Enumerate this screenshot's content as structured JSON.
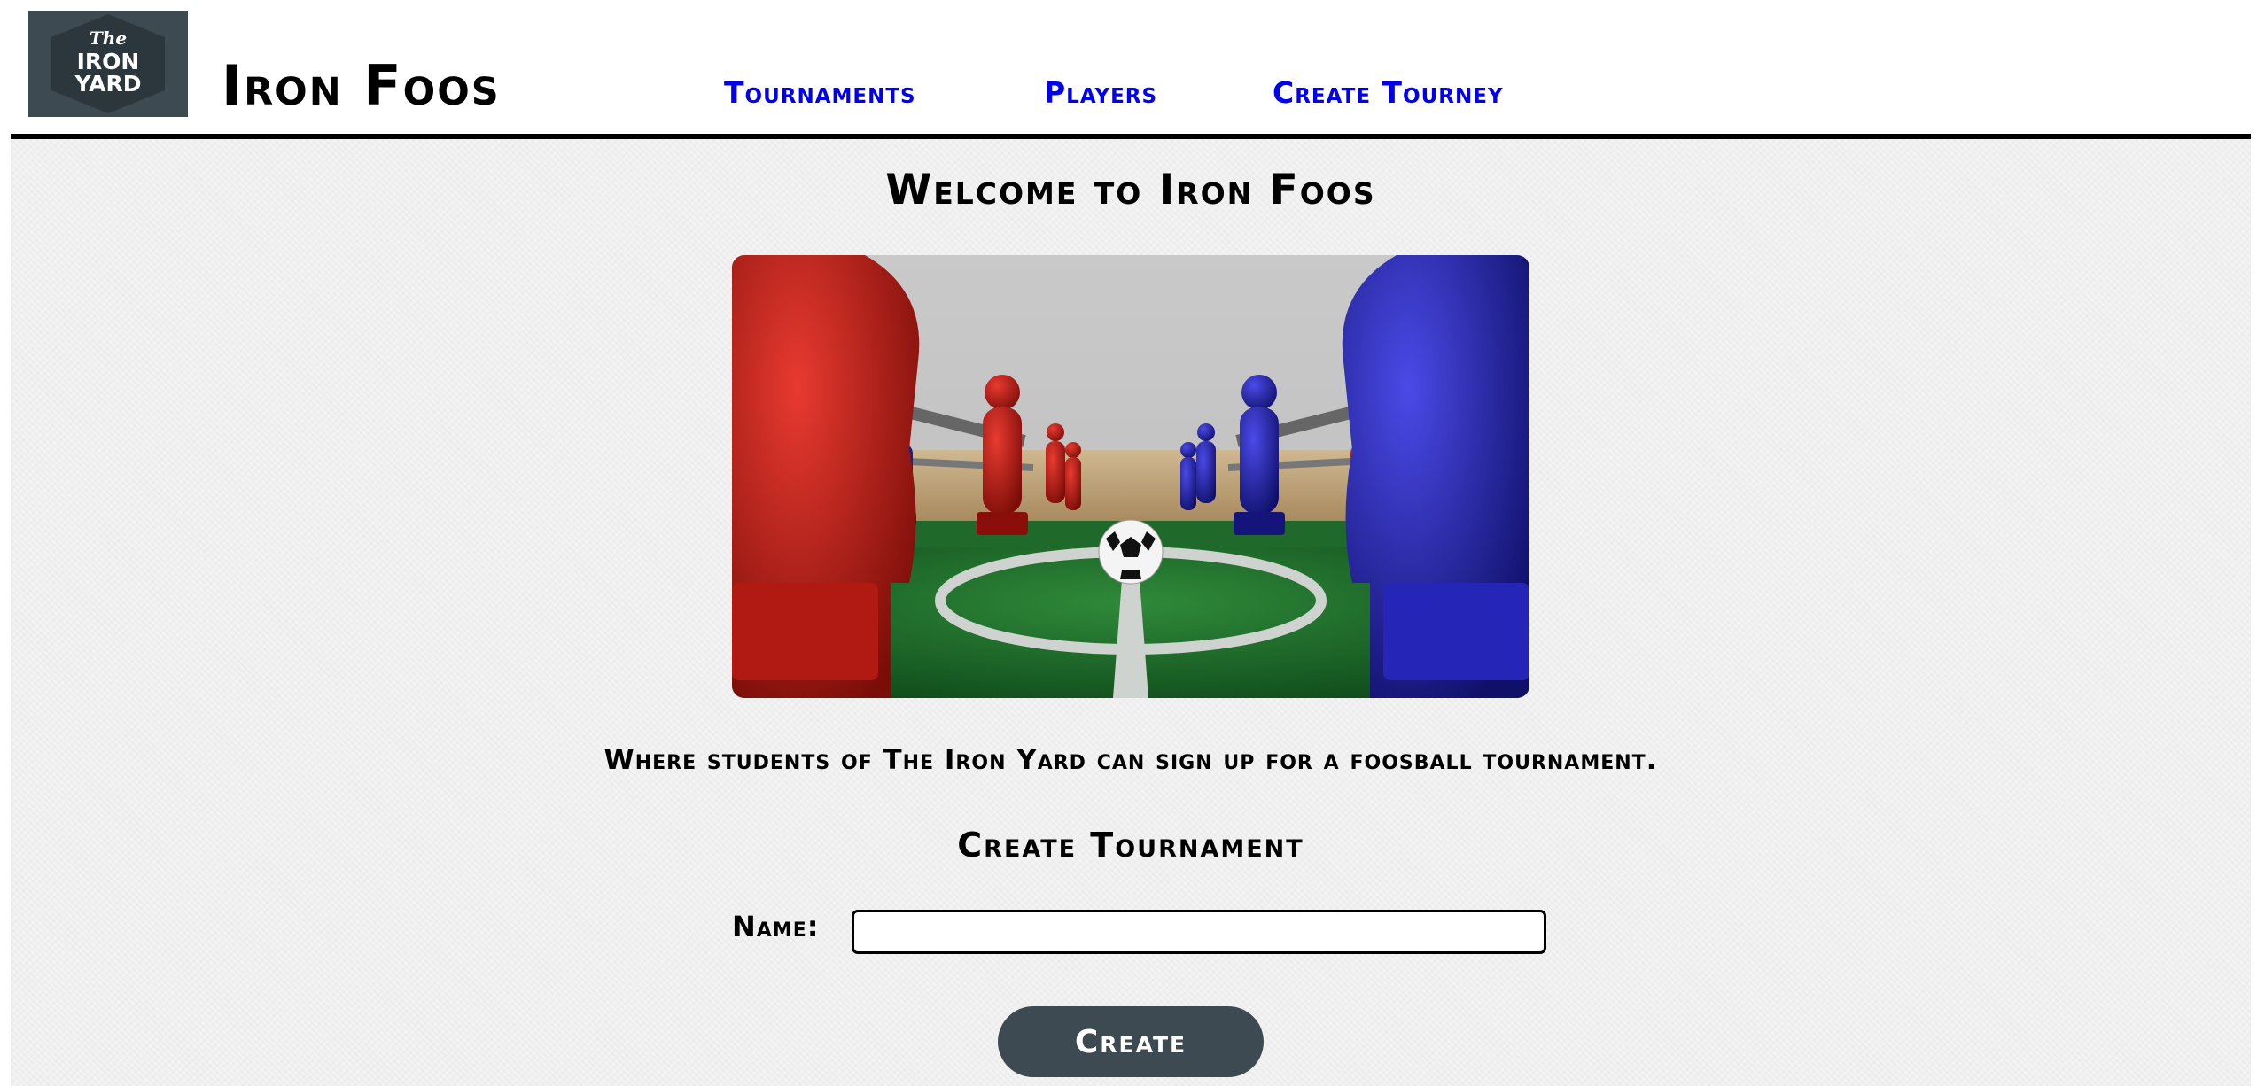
{
  "header": {
    "logo_text": [
      "The",
      "IRON",
      "YARD"
    ],
    "title": "Iron Foos",
    "nav": [
      {
        "label": "Tournaments"
      },
      {
        "label": "Players"
      },
      {
        "label": "Create Tourney"
      }
    ]
  },
  "main": {
    "welcome": "Welcome to Iron Foos",
    "hero_image": "foosball-table-image",
    "tagline": "Where students of The Iron Yard can sign up for a foosball tournament.",
    "form": {
      "title": "Create Tournament",
      "name_label": "Name:",
      "name_value": "",
      "submit_label": "Create"
    }
  },
  "colors": {
    "link": "#0000ee",
    "logo_bg": "#3d4a52",
    "button_bg": "#3d4a52",
    "page_bg": "#f3f3f3"
  }
}
